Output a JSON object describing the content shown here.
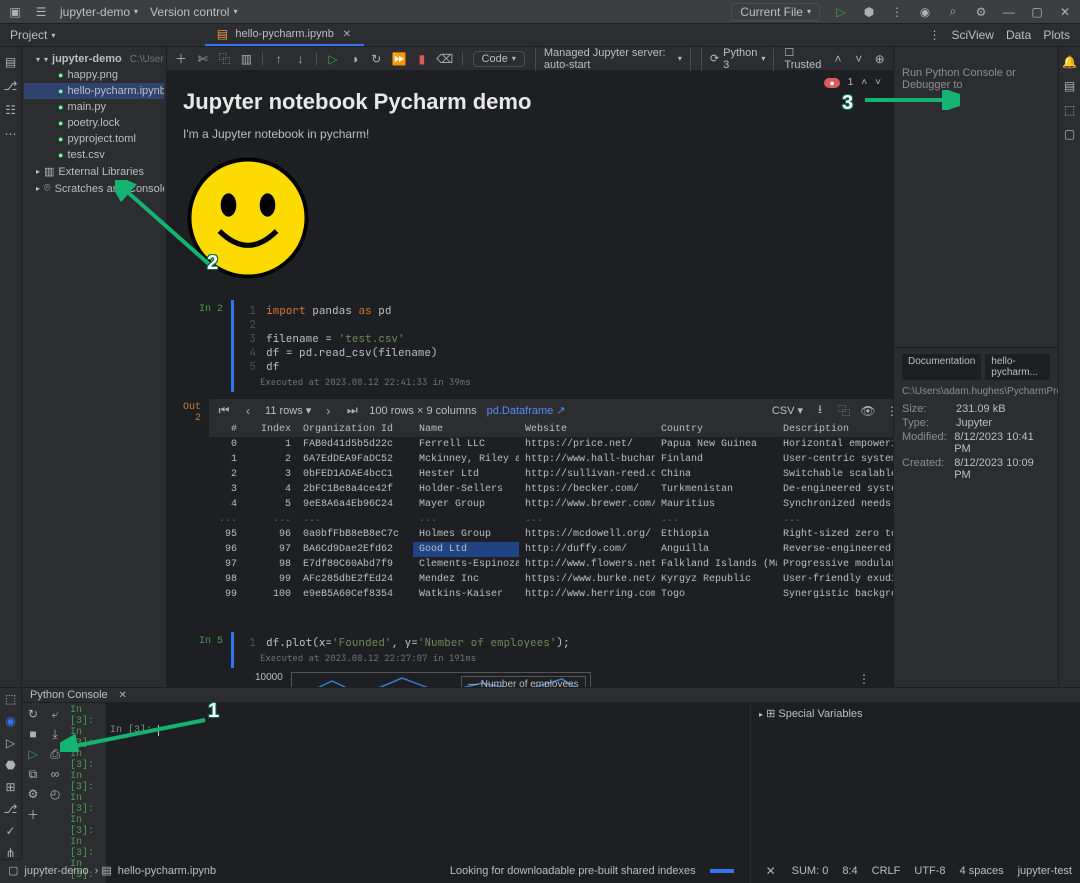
{
  "titlebar": {
    "project_dropdown": "jupyter-demo",
    "vcs": "Version control",
    "run_config": "Current File"
  },
  "project_tool": {
    "label": "Project",
    "root": "jupyter-demo",
    "root_path": "C:\\Users\\ada",
    "files": [
      "happy.png",
      "hello-pycharm.ipynb",
      "main.py",
      "poetry.lock",
      "pyproject.toml",
      "test.csv"
    ],
    "ext_libs": "External Libraries",
    "scratches": "Scratches and Consoles"
  },
  "editor_tab": "hello-pycharm.ipynb",
  "right_tabs": [
    "SciView",
    "Data",
    "Plots"
  ],
  "nb_toolbar": {
    "cell_type": "Code",
    "server": "Managed Jupyter server: auto-start",
    "interpreter": "Python 3",
    "trusted": "Trusted"
  },
  "nb_problems": "1",
  "markdown": {
    "h1": "Jupyter notebook Pycharm demo",
    "p": "I'm a Jupyter notebook in pycharm!"
  },
  "code_cell": {
    "prompt": "In 2",
    "lines": [
      {
        "n": "1",
        "html": "<span class='kw'>import</span> <span class='ident'>pandas</span> <span class='kw'>as</span> <span class='ident'>pd</span>"
      },
      {
        "n": "2",
        "html": ""
      },
      {
        "n": "3",
        "html": "<span class='ident'>filename</span> = <span class='str'>'test.csv'</span>"
      },
      {
        "n": "4",
        "html": "<span class='ident'>df</span> = pd.read_csv(filename)"
      },
      {
        "n": "5",
        "html": "<span class='ident'>df</span>"
      }
    ],
    "executed": "Executed at 2023.08.12 22:41:33 in 39ms"
  },
  "out_prompt": "Out 2",
  "df_toolbar": {
    "rows_label": "11 rows",
    "shape": "100 rows × 9 columns",
    "type": "pd.Dataframe",
    "export": "CSV"
  },
  "df": {
    "columns": [
      "#",
      "Index",
      "Organization Id",
      "Name",
      "Website",
      "Country",
      "Description"
    ],
    "rows": [
      [
        "0",
        "1",
        "FAB0d41d5b5d22c",
        "Ferrell LLC",
        "https://price.net/",
        "Papua New Guinea",
        "Horizontal empowering kno"
      ],
      [
        "1",
        "2",
        "6A7EdDEA9FaDC52",
        "Mckinney, Riley and Day",
        "http://www.hall-buchanan.info/",
        "Finland",
        "User-centric system-worth"
      ],
      [
        "2",
        "3",
        "0bFED1ADAE4bcC1",
        "Hester Ltd",
        "http://sullivan-reed.com/",
        "China",
        "Switchable scalable morat"
      ],
      [
        "3",
        "4",
        "2bFC1Be8a4ce42f",
        "Holder-Sellers",
        "https://becker.com/",
        "Turkmenistan",
        "De-engineered systemic ar"
      ],
      [
        "4",
        "5",
        "9eE8A6a4Eb96C24",
        "Mayer Group",
        "http://www.brewer.com/",
        "Mauritius",
        "Synchronized needs-based"
      ],
      [
        "...",
        "...",
        "...",
        "...",
        "...",
        "...",
        "..."
      ],
      [
        "95",
        "96",
        "0a0bfFbB8eB8eC7c",
        "Holmes Group",
        "https://mcdowell.org/",
        "Ethiopia",
        "Right-sized zero toleranc"
      ],
      [
        "96",
        "97",
        "BA6Cd9Dae2Efd62",
        "Good Ltd",
        "http://duffy.com/",
        "Anguilla",
        "Reverse-engineered compos"
      ],
      [
        "97",
        "98",
        "E7df80C60Abd7f9",
        "Clements-Espinoza",
        "http://www.flowers.net/",
        "Falkland Islands (Malvinas)",
        "Progressive modular hub"
      ],
      [
        "98",
        "99",
        "AFc285dbE2fEd24",
        "Mendez Inc",
        "https://www.burke.net/",
        "Kyrgyz Republic",
        "User-friendly exuding mig"
      ],
      [
        "99",
        "100",
        "e9eB5A60Cef8354",
        "Watkins-Kaiser",
        "http://www.herring.com/",
        "Togo",
        "Synergistic background ac"
      ]
    ],
    "highlight_row": 7
  },
  "plot_cell": {
    "prompt": "In 5",
    "code": "df.plot(x='Founded', y='Number of employees');",
    "executed": "Executed at 2023.08.12 22:27:07 in 191ms"
  },
  "chart_data": {
    "type": "line",
    "legend": "Number of employees",
    "y_tick": "10000"
  },
  "sidebar_doc": {
    "tabs": [
      "Documentation",
      "hello-pycharm..."
    ],
    "path": "C:\\Users\\adam.hughes\\PycharmPro",
    "size_k": "Size:",
    "size": "231.09 kB",
    "type_k": "Type:",
    "type": "Jupyter",
    "mod_k": "Modified:",
    "mod": "8/12/2023 10:41 PM",
    "cre_k": "Created:",
    "cre": "8/12/2023 10:09 PM",
    "hint": "Run Python Console or Debugger to"
  },
  "console": {
    "tab": "Python Console",
    "prompts": [
      "In [3]:",
      "In [3]:",
      "In [3]:",
      "In [3]:",
      "In [3]:",
      "In [3]:",
      "In [3]:",
      "In [3]:"
    ],
    "current": "In [3]:",
    "vars": "Special Variables"
  },
  "status": {
    "crumb1": "jupyter-demo",
    "crumb2": "hello-pycharm.ipynb",
    "indexing": "Looking for downloadable pre-built shared indexes",
    "sum": "SUM: 0",
    "pos": "8:4",
    "sep": "CRLF",
    "enc": "UTF-8",
    "indent": "4 spaces",
    "interp": "jupyter-test"
  }
}
